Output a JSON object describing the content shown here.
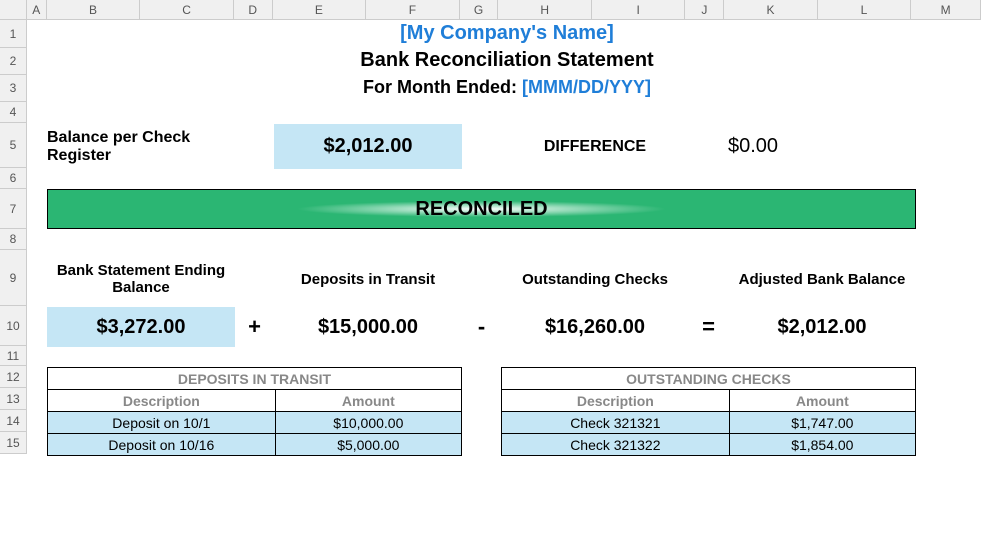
{
  "columns": [
    "A",
    "B",
    "C",
    "D",
    "E",
    "F",
    "G",
    "H",
    "I",
    "J",
    "K",
    "L",
    "M"
  ],
  "rows": [
    "1",
    "2",
    "3",
    "4",
    "5",
    "6",
    "7",
    "8",
    "9",
    "10",
    "11",
    "12",
    "13",
    "14",
    "15"
  ],
  "header": {
    "company": "[My Company's Name]",
    "stmt": "Bank Reconciliation Statement",
    "period_label": "For Month Ended:",
    "period_value": "[MMM/DD/YYY]"
  },
  "balance": {
    "label": "Balance per Check Register",
    "value": "$2,012.00",
    "diff_label": "DIFFERENCE",
    "diff_value": "$0.00"
  },
  "banner": "RECONCILED",
  "calc": {
    "c1_label": "Bank Statement Ending Balance",
    "c1_value": "$3,272.00",
    "op1": "+",
    "c2_label": "Deposits in Transit",
    "c2_value": "$15,000.00",
    "op2": "-",
    "c3_label": "Outstanding Checks",
    "c3_value": "$16,260.00",
    "op3": "=",
    "c4_label": "Adjusted Bank Balance",
    "c4_value": "$2,012.00"
  },
  "deposits": {
    "title": "DEPOSITS IN TRANSIT",
    "col1": "Description",
    "col2": "Amount",
    "rows": [
      {
        "desc": "Deposit on 10/1",
        "amt": "$10,000.00"
      },
      {
        "desc": "Deposit on 10/16",
        "amt": "$5,000.00"
      }
    ]
  },
  "checks": {
    "title": "OUTSTANDING CHECKS",
    "col1": "Description",
    "col2": "Amount",
    "rows": [
      {
        "desc": "Check 321321",
        "amt": "$1,747.00"
      },
      {
        "desc": "Check 321322",
        "amt": "$1,854.00"
      }
    ]
  }
}
